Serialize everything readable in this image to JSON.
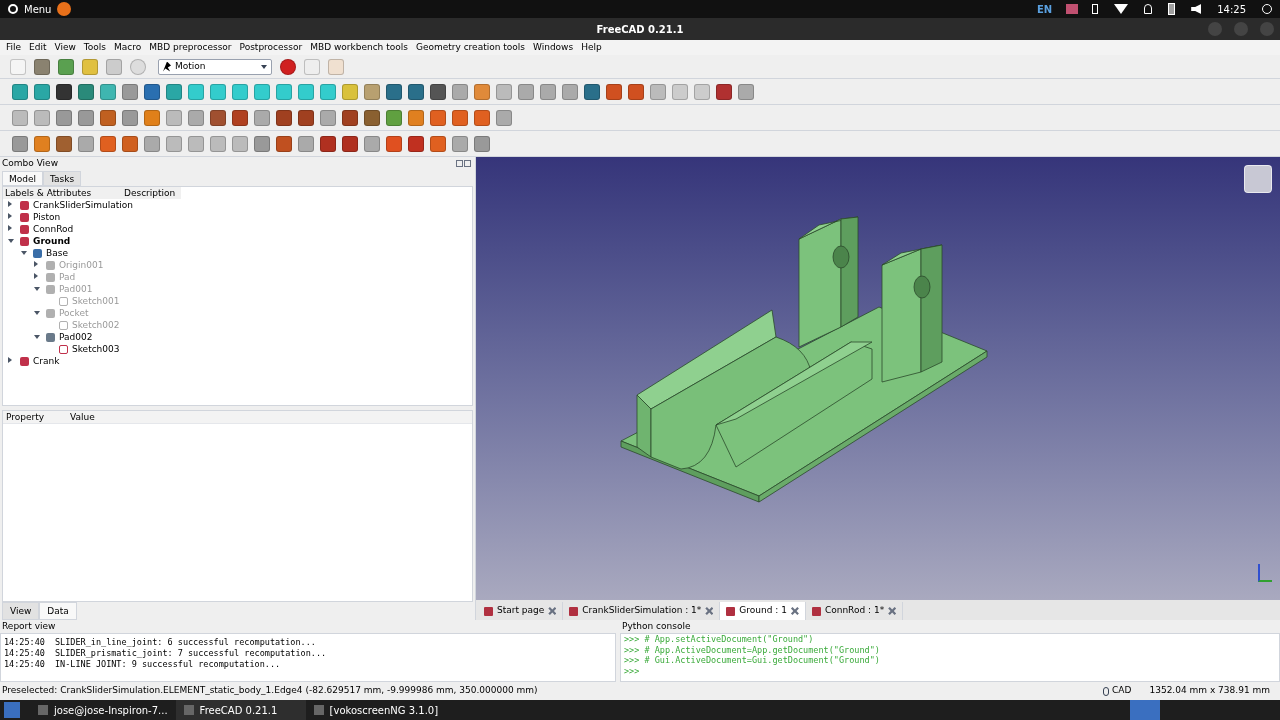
{
  "system_bar": {
    "menu": "Menu",
    "language": "EN",
    "time": "14:25"
  },
  "window": {
    "title": "FreeCAD 0.21.1"
  },
  "menu": [
    "File",
    "Edit",
    "View",
    "Tools",
    "Macro",
    "MBD preprocessor",
    "Postprocessor",
    "MBD workbench tools",
    "Geometry creation tools",
    "Windows",
    "Help"
  ],
  "workbench": {
    "value": "Motion"
  },
  "combo_view": {
    "title": "Combo View",
    "tabs": [
      {
        "label": "Model",
        "selected": true
      },
      {
        "label": "Tasks",
        "selected": false
      }
    ],
    "columns": [
      "Labels & Attributes",
      "Description"
    ],
    "tree": [
      {
        "label": "CrankSliderSimulation",
        "kind": "document",
        "expandable": true,
        "expanded": false,
        "visible": true,
        "active": false
      },
      {
        "label": "Piston",
        "kind": "document",
        "expandable": true,
        "expanded": false,
        "visible": true,
        "active": false
      },
      {
        "label": "ConnRod",
        "kind": "document",
        "expandable": true,
        "expanded": false,
        "visible": true,
        "active": false
      },
      {
        "label": "Ground",
        "kind": "document",
        "expandable": true,
        "expanded": true,
        "visible": true,
        "active": true,
        "children": [
          {
            "label": "Base",
            "kind": "body",
            "expandable": true,
            "expanded": true,
            "visible": true,
            "active": false,
            "children": [
              {
                "label": "Origin001",
                "kind": "origin",
                "expandable": true,
                "expanded": false,
                "visible": false,
                "active": false
              },
              {
                "label": "Pad",
                "kind": "feature",
                "expandable": true,
                "expanded": false,
                "visible": false,
                "active": false
              },
              {
                "label": "Pad001",
                "kind": "feature",
                "expandable": true,
                "expanded": true,
                "visible": false,
                "active": false,
                "children": [
                  {
                    "label": "Sketch001",
                    "kind": "sketch",
                    "expandable": false,
                    "expanded": false,
                    "visible": false,
                    "active": false
                  }
                ]
              },
              {
                "label": "Pocket",
                "kind": "feature",
                "expandable": true,
                "expanded": true,
                "visible": false,
                "active": false,
                "children": [
                  {
                    "label": "Sketch002",
                    "kind": "sketch",
                    "expandable": false,
                    "expanded": false,
                    "visible": false,
                    "active": false
                  }
                ]
              },
              {
                "label": "Pad002",
                "kind": "feature",
                "expandable": true,
                "expanded": true,
                "visible": true,
                "active": false,
                "children": [
                  {
                    "label": "Sketch003",
                    "kind": "sketch",
                    "expandable": false,
                    "expanded": false,
                    "visible": true,
                    "active": false
                  }
                ]
              }
            ]
          }
        ]
      },
      {
        "label": "Crank",
        "kind": "document",
        "expandable": true,
        "expanded": false,
        "visible": true,
        "active": false
      }
    ],
    "property_columns": [
      "Property",
      "Value"
    ],
    "bottom_tabs": [
      {
        "label": "View",
        "selected": false
      },
      {
        "label": "Data",
        "selected": true
      }
    ]
  },
  "document_tabs": [
    {
      "label": "Start page",
      "selected": false
    },
    {
      "label": "CrankSliderSimulation : 1*",
      "selected": false
    },
    {
      "label": "Ground : 1",
      "selected": true
    },
    {
      "label": "ConnRod : 1*",
      "selected": false
    }
  ],
  "report_view": {
    "title": "Report view",
    "lines": [
      {
        "time": "14:25:40",
        "text": "SLIDER_in_line_joint: 6 successful recomputation..."
      },
      {
        "time": "14:25:40",
        "text": "SLIDER_prismatic_joint: 7 successful recomputation..."
      },
      {
        "time": "14:25:40",
        "text": "IN-LINE JOINT: 9 successful recomputation..."
      }
    ]
  },
  "python_console": {
    "title": "Python console",
    "lines": [
      ">>> # App.setActiveDocument(\"Ground\")",
      ">>> # App.ActiveDocument=App.getDocument(\"Ground\")",
      ">>> # Gui.ActiveDocument=Gui.getDocument(\"Ground\")",
      ">>>"
    ]
  },
  "status_bar": {
    "message": "Preselected: CrankSliderSimulation.ELEMENT_static_body_1.Edge4 (-82.629517 mm, -9.999986 mm, 350.000000 mm)",
    "navigation": "CAD",
    "dimensions": "1352.04 mm x 738.91 mm"
  },
  "taskbar": [
    {
      "label": "jose@jose-Inspiron-7...",
      "selected": false
    },
    {
      "label": "FreeCAD 0.21.1",
      "selected": true
    },
    {
      "label": "[vokoscreenNG 3.1.0]",
      "selected": false
    }
  ]
}
